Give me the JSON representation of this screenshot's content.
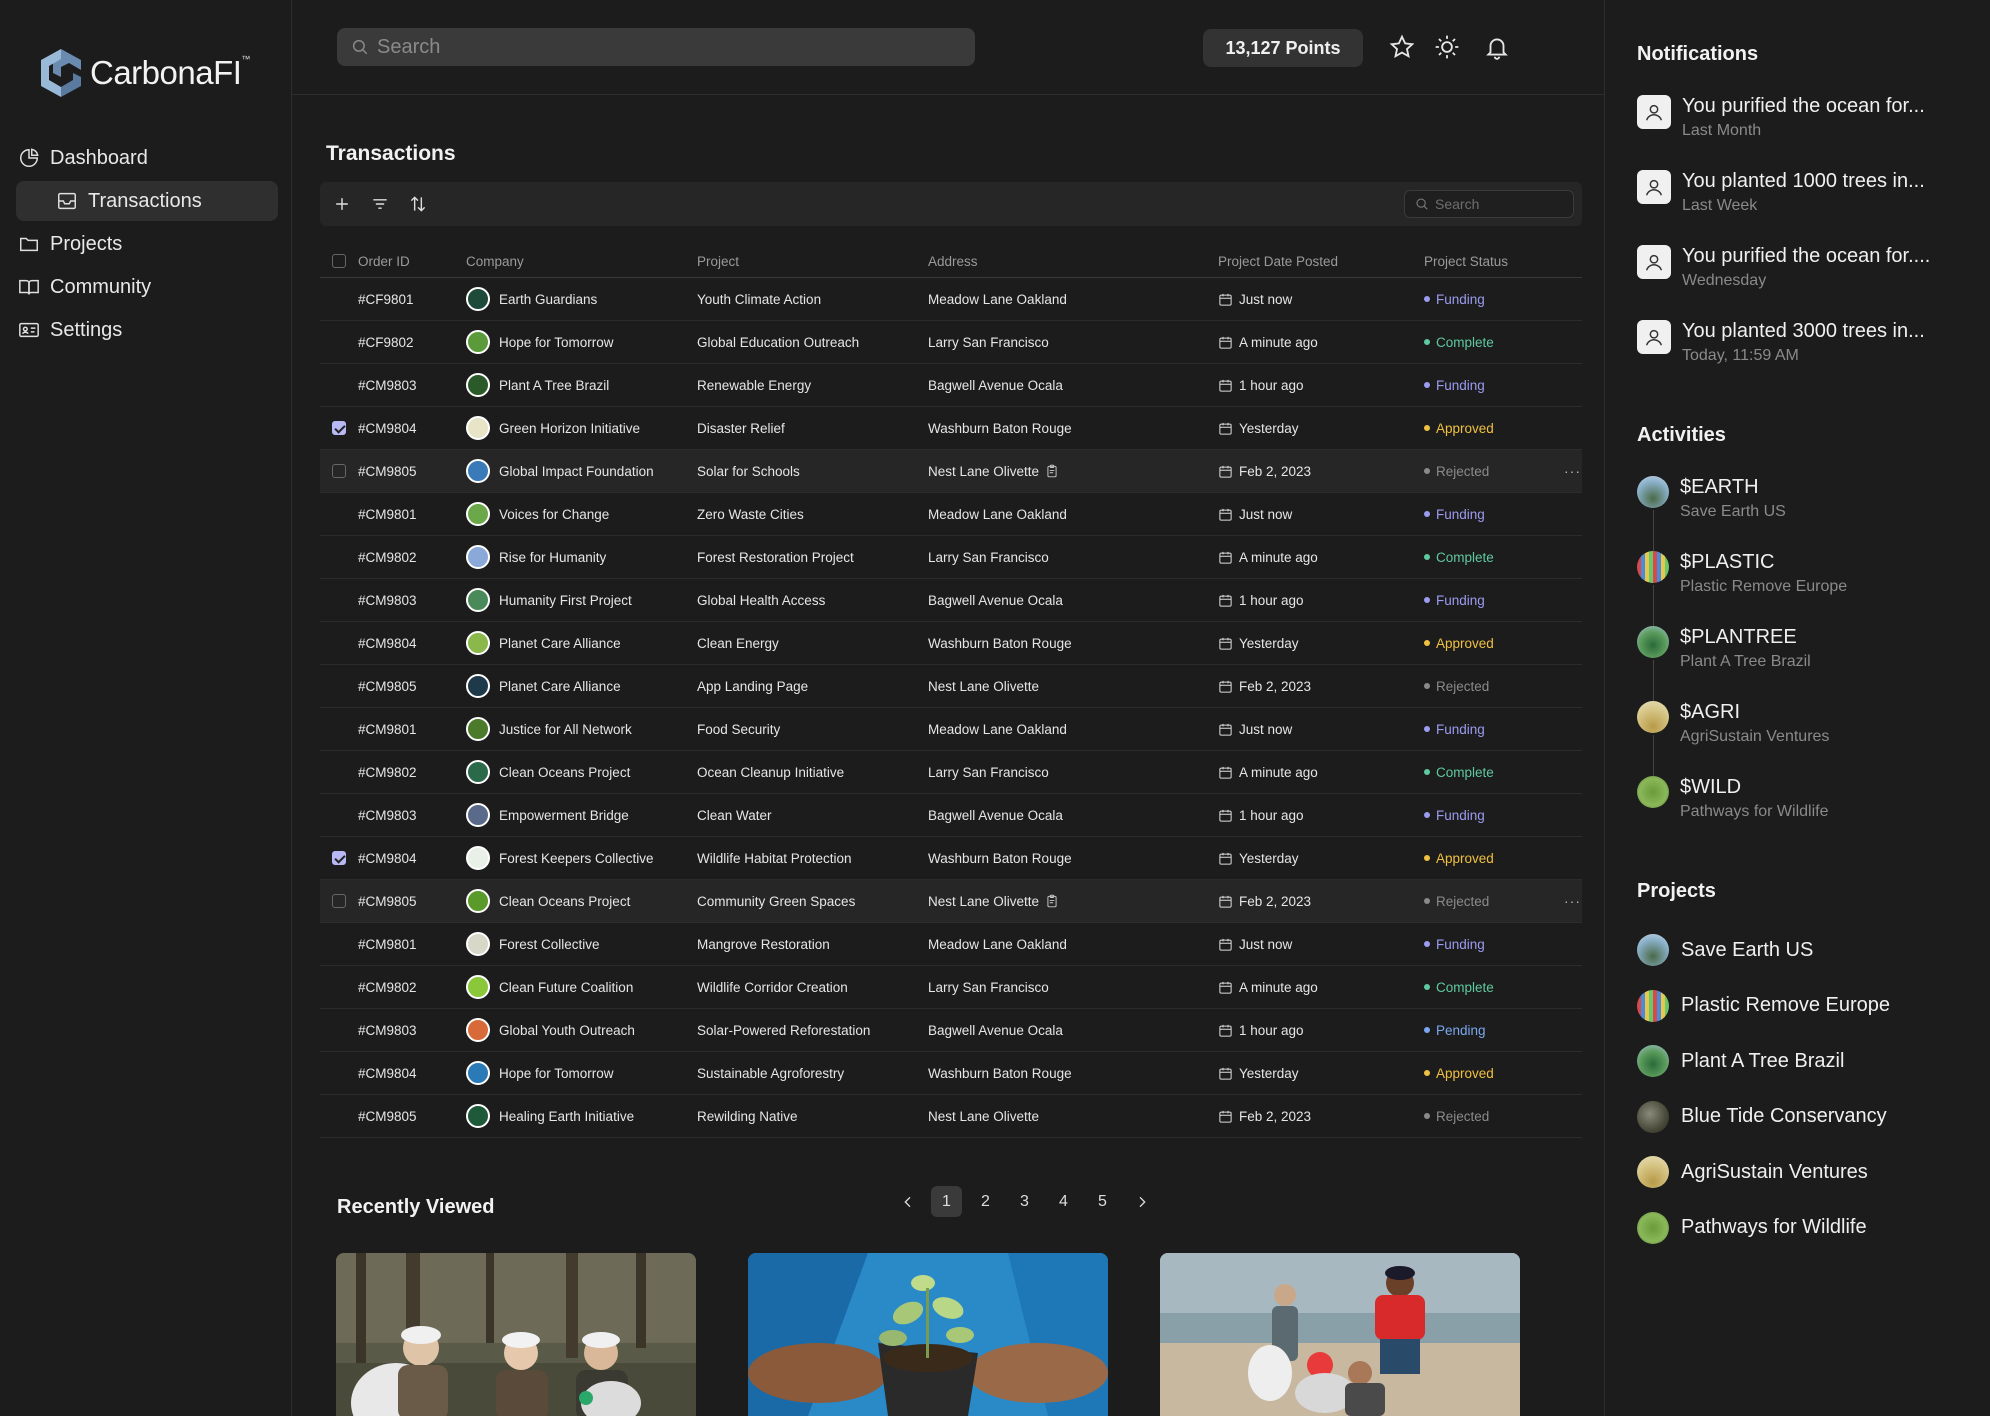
{
  "app": {
    "logo_text": "CarbonaFI",
    "logo_tm": "™"
  },
  "nav": {
    "dashboard": "Dashboard",
    "transactions": "Transactions",
    "projects": "Projects",
    "community": "Community",
    "settings": "Settings"
  },
  "topbar": {
    "search_placeholder": "Search",
    "points": "13,127 Points"
  },
  "main": {
    "title": "Transactions",
    "table_search_placeholder": "Search",
    "columns": [
      "Order ID",
      "Company",
      "Project",
      "Address",
      "Project Date Posted",
      "Project Status"
    ],
    "rows": [
      {
        "id": "#CF9801",
        "company": "Earth Guardians",
        "project": "Youth Climate Action",
        "address": "Meadow Lane Oakland",
        "date": "Just now",
        "status": "Funding",
        "avatar": "#1e4a3a",
        "checkbox": "none",
        "highlight": false
      },
      {
        "id": "#CF9802",
        "company": "Hope for Tomorrow",
        "project": "Global Education Outreach",
        "address": "Larry San Francisco",
        "date": "A minute ago",
        "status": "Complete",
        "avatar": "#5a9a3a",
        "checkbox": "none",
        "highlight": false
      },
      {
        "id": "#CM9803",
        "company": "Plant A Tree Brazil",
        "project": "Renewable Energy",
        "address": "Bagwell Avenue Ocala",
        "date": "1 hour ago",
        "status": "Funding",
        "avatar": "#2a5a2a",
        "checkbox": "none",
        "highlight": false
      },
      {
        "id": "#CM9804",
        "company": "Green Horizon Initiative",
        "project": "Disaster Relief",
        "address": "Washburn Baton Rouge",
        "date": "Yesterday",
        "status": "Approved",
        "avatar": "#e8e4c8",
        "checkbox": "checked",
        "highlight": false
      },
      {
        "id": "#CM9805",
        "company": "Global Impact Foundation",
        "project": "Solar for Schools",
        "address": "Nest Lane Olivette",
        "date": "Feb 2, 2023",
        "status": "Rejected",
        "avatar": "#3a7ab8",
        "checkbox": "empty",
        "highlight": true,
        "clip": true,
        "more": true
      },
      {
        "id": "#CM9801",
        "company": "Voices for Change",
        "project": "Zero Waste Cities",
        "address": "Meadow Lane Oakland",
        "date": "Just now",
        "status": "Funding",
        "avatar": "#6aa84a",
        "checkbox": "none",
        "highlight": false
      },
      {
        "id": "#CM9802",
        "company": "Rise for Humanity",
        "project": "Forest Restoration Project",
        "address": "Larry San Francisco",
        "date": "A minute ago",
        "status": "Complete",
        "avatar": "#8aa8d8",
        "checkbox": "none",
        "highlight": false
      },
      {
        "id": "#CM9803",
        "company": "Humanity First Project",
        "project": "Global Health Access",
        "address": "Bagwell Avenue Ocala",
        "date": "1 hour ago",
        "status": "Funding",
        "avatar": "#4a8a5a",
        "checkbox": "none",
        "highlight": false
      },
      {
        "id": "#CM9804",
        "company": "Planet Care Alliance",
        "project": "Clean Energy",
        "address": "Washburn Baton Rouge",
        "date": "Yesterday",
        "status": "Approved",
        "avatar": "#8ab84a",
        "checkbox": "none",
        "highlight": false
      },
      {
        "id": "#CM9805",
        "company": "Planet Care Alliance",
        "project": "App Landing Page",
        "address": "Nest Lane Olivette",
        "date": "Feb 2, 2023",
        "status": "Rejected",
        "avatar": "#1e3a4a",
        "checkbox": "none",
        "highlight": false
      },
      {
        "id": "#CM9801",
        "company": "Justice for All Network",
        "project": "Food Security",
        "address": "Meadow Lane Oakland",
        "date": "Just now",
        "status": "Funding",
        "avatar": "#4a7a2a",
        "checkbox": "none",
        "highlight": false
      },
      {
        "id": "#CM9802",
        "company": "Clean Oceans Project",
        "project": "Ocean Cleanup Initiative",
        "address": "Larry San Francisco",
        "date": "A minute ago",
        "status": "Complete",
        "avatar": "#2a6a4a",
        "checkbox": "none",
        "highlight": false
      },
      {
        "id": "#CM9803",
        "company": "Empowerment Bridge",
        "project": "Clean Water",
        "address": "Bagwell Avenue Ocala",
        "date": "1 hour ago",
        "status": "Funding",
        "avatar": "#5a6a8a",
        "checkbox": "none",
        "highlight": false
      },
      {
        "id": "#CM9804",
        "company": "Forest Keepers Collective",
        "project": "Wildlife Habitat Protection",
        "address": "Washburn Baton Rouge",
        "date": "Yesterday",
        "status": "Approved",
        "avatar": "#e8f0e8",
        "checkbox": "checked",
        "highlight": false
      },
      {
        "id": "#CM9805",
        "company": "Clean Oceans Project",
        "project": "Community Green Spaces",
        "address": "Nest Lane Olivette",
        "date": "Feb 2, 2023",
        "status": "Rejected",
        "avatar": "#5a9a2a",
        "checkbox": "empty",
        "highlight": true,
        "clip": true,
        "more": true
      },
      {
        "id": "#CM9801",
        "company": "Forest Collective",
        "project": "Mangrove Restoration",
        "address": "Meadow Lane Oakland",
        "date": "Just now",
        "status": "Funding",
        "avatar": "#d8d8c8",
        "checkbox": "none",
        "highlight": false
      },
      {
        "id": "#CM9802",
        "company": "Clean Future Coalition",
        "project": "Wildlife Corridor Creation",
        "address": "Larry San Francisco",
        "date": "A minute ago",
        "status": "Complete",
        "avatar": "#8ac83a",
        "checkbox": "none",
        "highlight": false
      },
      {
        "id": "#CM9803",
        "company": "Global Youth Outreach",
        "project": "Solar-Powered Reforestation",
        "address": "Bagwell Avenue Ocala",
        "date": "1 hour ago",
        "status": "Pending",
        "avatar": "#d86a3a",
        "checkbox": "none",
        "highlight": false
      },
      {
        "id": "#CM9804",
        "company": "Hope for Tomorrow",
        "project": "Sustainable Agroforestry",
        "address": "Washburn Baton Rouge",
        "date": "Yesterday",
        "status": "Approved",
        "avatar": "#2a7ab8",
        "checkbox": "none",
        "highlight": false
      },
      {
        "id": "#CM9805",
        "company": "Healing Earth Initiative",
        "project": "Rewilding Native",
        "address": "Nest Lane Olivette",
        "date": "Feb 2, 2023",
        "status": "Rejected",
        "avatar": "#1e5a3a",
        "checkbox": "none",
        "highlight": false
      }
    ],
    "status_colors": {
      "Funding": "#9b9bf0",
      "Complete": "#5fc9a0",
      "Approved": "#f0c040",
      "Rejected": "#8a8a8a",
      "Pending": "#7aa8f0"
    },
    "recently_viewed_title": "Recently Viewed",
    "pages": [
      "1",
      "2",
      "3",
      "4",
      "5"
    ],
    "active_page": "1"
  },
  "notifications": {
    "title": "Notifications",
    "items": [
      {
        "text": "You purified the ocean for...",
        "time": "Last Month"
      },
      {
        "text": "You planted 1000 trees in...",
        "time": "Last Week"
      },
      {
        "text": "You purified the ocean for....",
        "time": "Wednesday"
      },
      {
        "text": "You planted 3000 trees in...",
        "time": "Today, 11:59 AM"
      }
    ]
  },
  "activities": {
    "title": "Activities",
    "items": [
      {
        "ticker": "$EARTH",
        "name": "Save Earth US"
      },
      {
        "ticker": "$PLASTIC",
        "name": "Plastic Remove Europe"
      },
      {
        "ticker": "$PLANTREE",
        "name": "Plant A Tree Brazil"
      },
      {
        "ticker": "$AGRI",
        "name": "AgriSustain Ventures"
      },
      {
        "ticker": "$WILD",
        "name": "Pathways for Wildlife"
      }
    ]
  },
  "projects": {
    "title": "Projects",
    "items": [
      "Save Earth US",
      "Plastic Remove Europe",
      "Plant A Tree Brazil",
      "Blue Tide Conservancy",
      "AgriSustain Ventures",
      "Pathways for Wildlife"
    ]
  }
}
